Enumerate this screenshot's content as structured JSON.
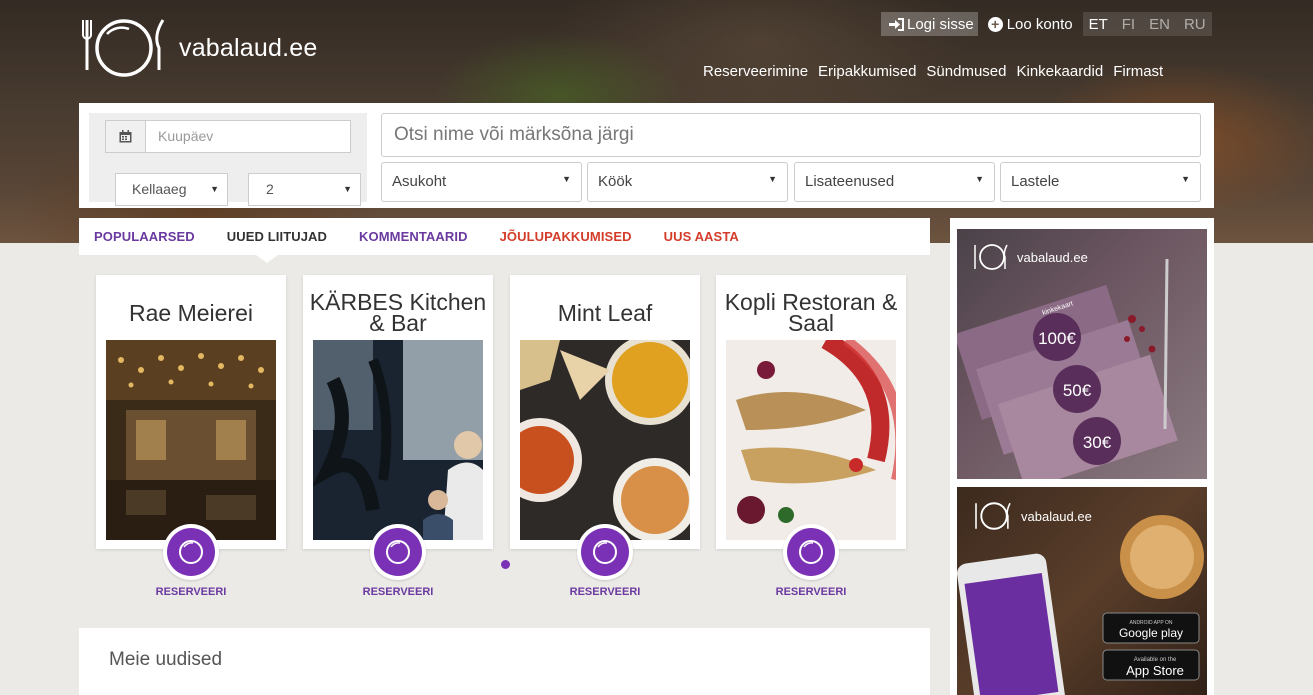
{
  "brand": {
    "name": "vabalaud.ee"
  },
  "topbar": {
    "login_label": "Logi sisse",
    "signup_label": "Loo konto",
    "languages": [
      "ET",
      "FI",
      "EN",
      "RU"
    ],
    "active_language": "ET"
  },
  "nav": {
    "items": [
      "Reserveerimine",
      "Eripakkumised",
      "Sündmused",
      "Kinkekaardid",
      "Firmast"
    ]
  },
  "search": {
    "date_placeholder": "Kuupäev",
    "time_label": "Kellaaeg",
    "people_value": "2",
    "query_placeholder": "Otsi nime või märksõna järgi",
    "filters": [
      "Asukoht",
      "Köök",
      "Lisateenused",
      "Lastele"
    ]
  },
  "tabs": {
    "items": [
      "POPULAARSED",
      "UUED LIITUJAD",
      "KOMMENTAARID",
      "JÕULUPAKKUMISED",
      "UUS AASTA"
    ],
    "active": "UUED LIITUJAD"
  },
  "restaurants": [
    {
      "name": "Rae Meierei",
      "action": "RESERVEERI"
    },
    {
      "name": "KÄRBES Kitchen & Bar",
      "action": "RESERVEERI"
    },
    {
      "name": "Mint Leaf",
      "action": "RESERVEERI"
    },
    {
      "name": "Kopli Restoran & Saal",
      "action": "RESERVEERI"
    }
  ],
  "news": {
    "heading": "Meie uudised"
  },
  "sidebar": {
    "gift_card_banner": {
      "brand": "vabalaud.ee",
      "card_label": "kinkekaart",
      "amounts": [
        "100€",
        "50€",
        "30€"
      ]
    },
    "app_banner": {
      "brand": "vabalaud.ee",
      "google_play_small": "ANDROID APP ON",
      "google_play": "Google play",
      "app_store_small": "Available on the",
      "app_store": "App Store"
    }
  },
  "colors": {
    "accent": "#7b31b5",
    "tab_red": "#d43c2a",
    "tab_purple": "#6a3aa0"
  }
}
